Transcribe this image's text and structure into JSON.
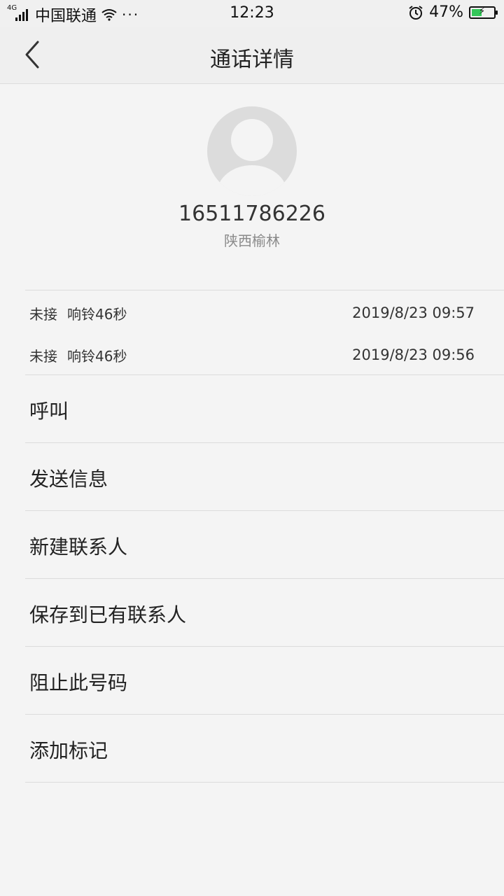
{
  "status_bar": {
    "network": "4G",
    "carrier": "中国联通",
    "more": "···",
    "time": "12:23",
    "battery": "47%",
    "battery_level": 0.47
  },
  "header": {
    "title": "通话详情"
  },
  "contact": {
    "phone": "16511786226",
    "location": "陕西榆林"
  },
  "call_log": [
    {
      "status": "未接",
      "ring": "响铃46秒",
      "time": "2019/8/23 09:57"
    },
    {
      "status": "未接",
      "ring": "响铃46秒",
      "time": "2019/8/23 09:56"
    }
  ],
  "actions": [
    {
      "label": "呼叫"
    },
    {
      "label": "发送信息"
    },
    {
      "label": "新建联系人"
    },
    {
      "label": "保存到已有联系人"
    },
    {
      "label": "阻止此号码"
    },
    {
      "label": "添加标记"
    }
  ]
}
